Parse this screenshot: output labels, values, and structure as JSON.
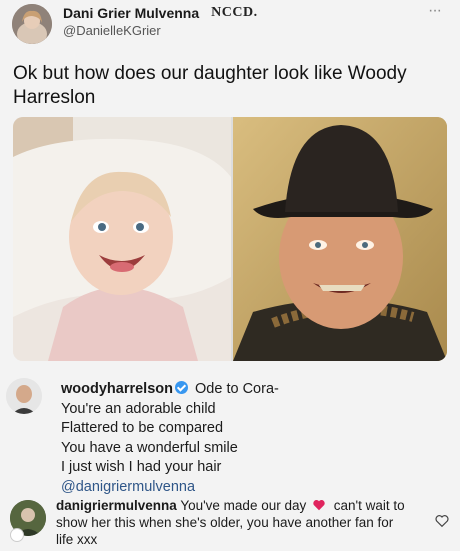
{
  "tweet": {
    "display_name": "Dani Grier Mulvenna",
    "brand_logo_text": "NCCD.",
    "handle": "@DanielleKGrier",
    "more_icon": "ellipsis-icon",
    "text": "Ok but how does our daughter look like Woody Harreslon"
  },
  "comments": [
    {
      "username": "woodyharrelson",
      "verified": true,
      "lines": [
        "Ode to Cora-",
        "You're an adorable child",
        "Flattered to be compared",
        "You have a wonderful smile",
        "I just wish I had your hair"
      ],
      "mention": "@danigriermulvenna"
    },
    {
      "username": "danigriermulvenna",
      "text_before_emoji": "You've made our day",
      "emoji": "red-heart",
      "text_after_emoji": "can't wait to show her this when she's older, you have another fan for life xxx",
      "like_icon": "heart-outline-icon"
    }
  ],
  "colors": {
    "background": "#f3f3f3",
    "mention_blue": "#2f5688",
    "verified_blue": "#3897f0",
    "heart_red": "#e0245e"
  }
}
